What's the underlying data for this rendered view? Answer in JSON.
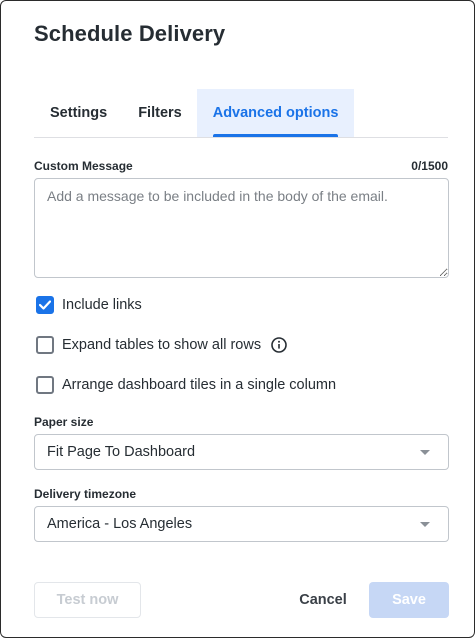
{
  "dialog": {
    "title": "Schedule Delivery"
  },
  "tabs": [
    {
      "label": "Settings",
      "active": false
    },
    {
      "label": "Filters",
      "active": false
    },
    {
      "label": "Advanced options",
      "active": true
    }
  ],
  "custom_message": {
    "label": "Custom Message",
    "counter": "0/1500",
    "value": "",
    "placeholder": "Add a message to be included in the body of the email."
  },
  "options": [
    {
      "label": "Include links",
      "checked": true,
      "info_icon": false
    },
    {
      "label": "Expand tables to show all rows",
      "checked": false,
      "info_icon": true
    },
    {
      "label": "Arrange dashboard tiles in a single column",
      "checked": false,
      "info_icon": false
    }
  ],
  "paper_size": {
    "label": "Paper size",
    "value": "Fit Page To Dashboard"
  },
  "delivery_timezone": {
    "label": "Delivery timezone",
    "value": "America - Los Angeles"
  },
  "footer": {
    "test_label": "Test now",
    "cancel_label": "Cancel",
    "save_label": "Save"
  },
  "colors": {
    "accent": "#1a73e8",
    "active_tab_bg": "#e8f0fe",
    "save_disabled_bg": "#c6d7f5"
  },
  "icons": {
    "check": "check-icon",
    "info": "info-icon",
    "dropdown": "chevron-down-icon"
  }
}
